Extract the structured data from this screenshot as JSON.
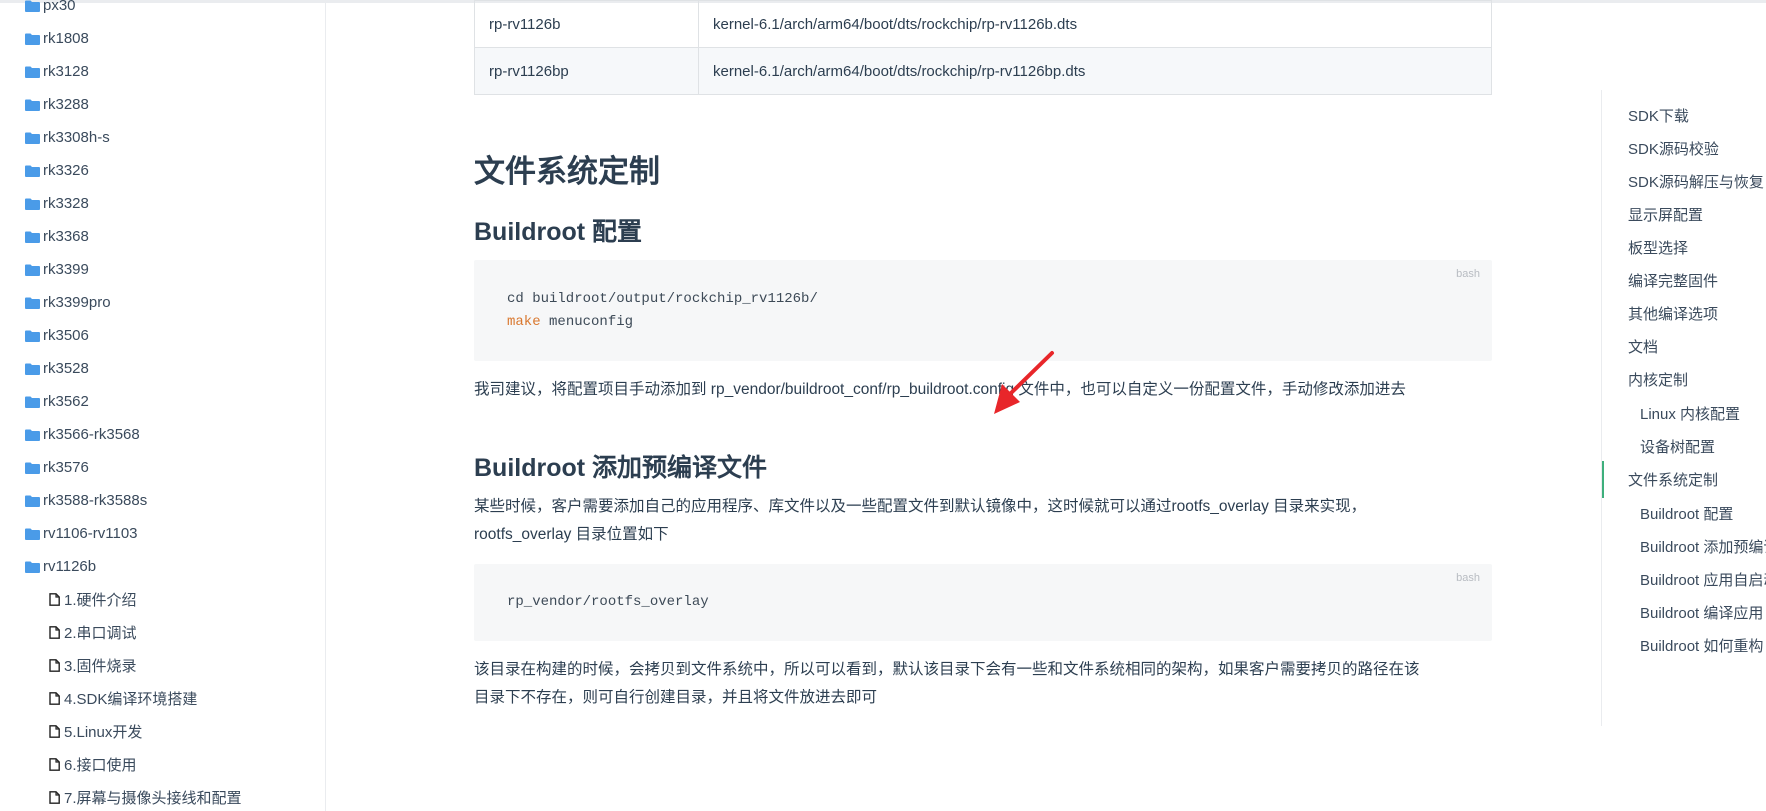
{
  "sidebar": {
    "items": [
      {
        "label": "px30",
        "kind": "folder"
      },
      {
        "label": "rk1808",
        "kind": "folder"
      },
      {
        "label": "rk3128",
        "kind": "folder"
      },
      {
        "label": "rk3288",
        "kind": "folder"
      },
      {
        "label": "rk3308h-s",
        "kind": "folder"
      },
      {
        "label": "rk3326",
        "kind": "folder"
      },
      {
        "label": "rk3328",
        "kind": "folder"
      },
      {
        "label": "rk3368",
        "kind": "folder"
      },
      {
        "label": "rk3399",
        "kind": "folder"
      },
      {
        "label": "rk3399pro",
        "kind": "folder"
      },
      {
        "label": "rk3506",
        "kind": "folder"
      },
      {
        "label": "rk3528",
        "kind": "folder"
      },
      {
        "label": "rk3562",
        "kind": "folder"
      },
      {
        "label": "rk3566-rk3568",
        "kind": "folder"
      },
      {
        "label": "rk3576",
        "kind": "folder"
      },
      {
        "label": "rk3588-rk3588s",
        "kind": "folder"
      },
      {
        "label": "rv1106-rv1103",
        "kind": "folder"
      },
      {
        "label": "rv1126b",
        "kind": "folder"
      },
      {
        "label": "1.硬件介绍",
        "kind": "file"
      },
      {
        "label": "2.串口调试",
        "kind": "file"
      },
      {
        "label": "3.固件烧录",
        "kind": "file"
      },
      {
        "label": "4.SDK编译环境搭建",
        "kind": "file"
      },
      {
        "label": "5.Linux开发",
        "kind": "file"
      },
      {
        "label": "6.接口使用",
        "kind": "file"
      },
      {
        "label": "7.屏幕与摄像头接线和配置",
        "kind": "file"
      }
    ]
  },
  "table": {
    "rows": [
      [
        "rp-rv1126b",
        "kernel-6.1/arch/arm64/boot/dts/rockchip/rp-rv1126b.dts"
      ],
      [
        "rp-rv1126bp",
        "kernel-6.1/arch/arm64/boot/dts/rockchip/rp-rv1126bp.dts"
      ]
    ]
  },
  "content": {
    "h2": "文件系统定制",
    "h3_buildroot_config": "Buildroot 配置",
    "code1": {
      "lang": "bash",
      "line1": "cd buildroot/output/rockchip_rv1126b/",
      "line2_keyword": "make",
      "line2_rest": " menuconfig"
    },
    "para1": "我司建议，将配置项目手动添加到 rp_vendor/buildroot_conf/rp_buildroot.config 文件中，也可以自定义一份配置文件，手动修改添加进去",
    "h3_prebuilt": "Buildroot 添加预编译文件",
    "para2_line1": "某些时候，客户需要添加自己的应用程序、库文件以及一些配置文件到默认镜像中，这时候就可以通过rootfs_overlay 目录来实现，",
    "para2_line2": "rootfs_overlay 目录位置如下",
    "code2": {
      "lang": "bash",
      "line1": "rp_vendor/rootfs_overlay"
    },
    "para3_line1": "该目录在构建的时候，会拷贝到文件系统中，所以可以看到，默认该目录下会有一些和文件系统相同的架构，如果客户需要拷贝的路径在该",
    "para3_line2": "目录下不存在，则可自行创建目录，并且将文件放进去即可"
  },
  "toc": {
    "items": [
      {
        "label": "SDK下载",
        "level": 1
      },
      {
        "label": "SDK源码校验",
        "level": 1
      },
      {
        "label": "SDK源码解压与恢复",
        "level": 1
      },
      {
        "label": "显示屏配置",
        "level": 1
      },
      {
        "label": "板型选择",
        "level": 1
      },
      {
        "label": "编译完整固件",
        "level": 1
      },
      {
        "label": "其他编译选项",
        "level": 1
      },
      {
        "label": "文档",
        "level": 1
      },
      {
        "label": "内核定制",
        "level": 1
      },
      {
        "label": "Linux 内核配置",
        "level": 2
      },
      {
        "label": "设备树配置",
        "level": 2
      },
      {
        "label": "文件系统定制",
        "level": 1,
        "active": true
      },
      {
        "label": "Buildroot 配置",
        "level": 2
      },
      {
        "label": "Buildroot 添加预编译文件",
        "level": 2
      },
      {
        "label": "Buildroot 应用自启动",
        "level": 2
      },
      {
        "label": "Buildroot 编译应用",
        "level": 2
      },
      {
        "label": "Buildroot 如何重构",
        "level": 2
      }
    ]
  },
  "colors": {
    "folder_icon": "#4a9be8",
    "toc_active_bar": "#3eaf7c",
    "keyword": "#d9782f",
    "annotation_arrow": "#e8262a"
  }
}
